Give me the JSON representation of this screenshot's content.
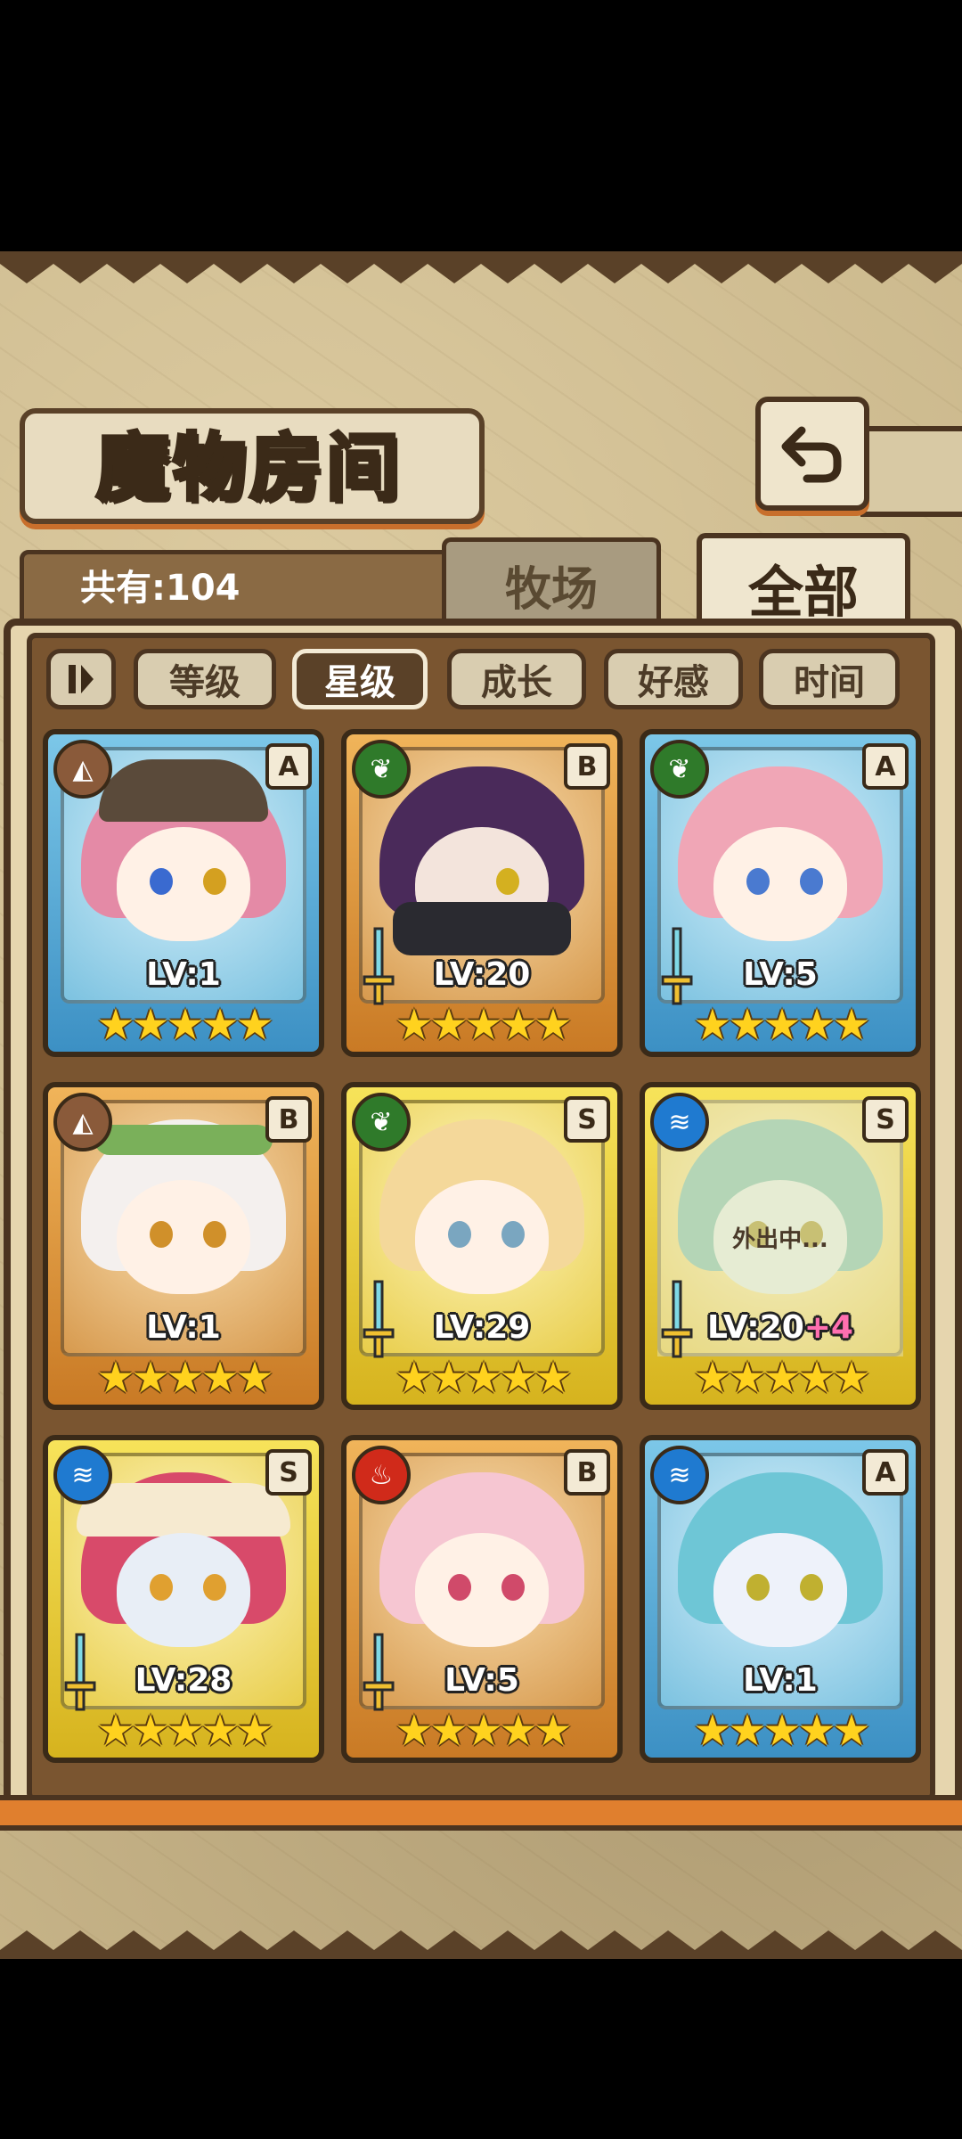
{
  "title": "魔物房间",
  "count_label": "共有:104",
  "tabs": [
    {
      "label": "牧场",
      "active": false
    },
    {
      "label": "全部",
      "active": true
    }
  ],
  "sort_toggle_icon": "pause-sort-icon",
  "sort_options": [
    {
      "label": "等级",
      "active": false
    },
    {
      "label": "星级",
      "active": true
    },
    {
      "label": "成长",
      "active": false
    },
    {
      "label": "好感",
      "active": false
    },
    {
      "label": "时间",
      "active": false
    }
  ],
  "monsters": [
    {
      "element": "earth",
      "rank": "A",
      "level": "LV:1",
      "stars": 5,
      "frame": "blue",
      "equipped": false,
      "away": false
    },
    {
      "element": "leaf",
      "rank": "B",
      "level": "LV:20",
      "stars": 5,
      "frame": "orange",
      "equipped": true,
      "away": false
    },
    {
      "element": "leaf",
      "rank": "A",
      "level": "LV:5",
      "stars": 5,
      "frame": "blue",
      "equipped": true,
      "away": false
    },
    {
      "element": "earth",
      "rank": "B",
      "level": "LV:1",
      "stars": 5,
      "frame": "orange",
      "equipped": false,
      "away": false
    },
    {
      "element": "leaf",
      "rank": "S",
      "level": "LV:29",
      "stars": 5,
      "frame": "yellow",
      "equipped": true,
      "away": false
    },
    {
      "element": "water",
      "rank": "S",
      "level": "LV:20",
      "level_bonus": "+4",
      "stars": 5,
      "frame": "yellow",
      "equipped": true,
      "away": true,
      "away_label": "外出中..."
    },
    {
      "element": "water",
      "rank": "S",
      "level": "LV:28",
      "stars": 5,
      "frame": "yellow",
      "equipped": true,
      "away": false
    },
    {
      "element": "fire",
      "rank": "B",
      "level": "LV:5",
      "stars": 5,
      "frame": "orange",
      "equipped": true,
      "away": false
    },
    {
      "element": "water",
      "rank": "A",
      "level": "LV:1",
      "stars": 5,
      "frame": "blue",
      "equipped": false,
      "away": false
    }
  ],
  "colors": {
    "panel_bg": "#c9b68a",
    "frame_dark": "#4b3420",
    "accent_orange": "#e07f2e",
    "star": "#ffd21e",
    "bonus": "#ff6fb0",
    "element_earth": "#8a5a3a",
    "element_leaf": "#2f7a2a",
    "element_water": "#1f7ad0",
    "element_fire": "#d02a1a"
  }
}
